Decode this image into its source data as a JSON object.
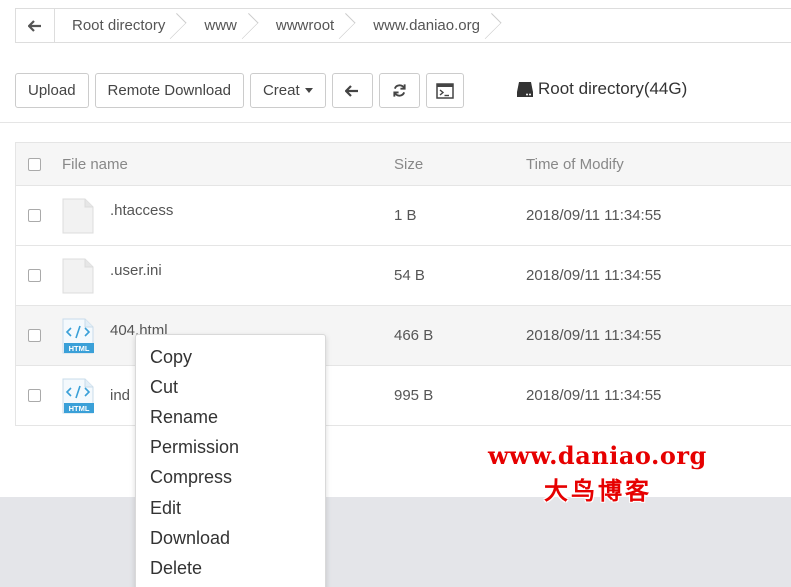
{
  "breadcrumb": {
    "items": [
      "Root directory",
      "www",
      "wwwroot",
      "www.daniao.org"
    ]
  },
  "toolbar": {
    "upload_label": "Upload",
    "remote_download_label": "Remote Download",
    "create_label": "Creat",
    "disk_label": "Root directory(44G)"
  },
  "table": {
    "headers": {
      "name": "File name",
      "size": "Size",
      "time": "Time of Modify"
    },
    "rows": [
      {
        "name": ".htaccess",
        "size": "1 B",
        "time": "2018/09/11 11:34:55",
        "type": "file"
      },
      {
        "name": ".user.ini",
        "size": "54 B",
        "time": "2018/09/11 11:34:55",
        "type": "file"
      },
      {
        "name": "404.html",
        "size": "466 B",
        "time": "2018/09/11 11:34:55",
        "type": "html"
      },
      {
        "name": "ind",
        "size": "995 B",
        "time": "2018/09/11 11:34:55",
        "type": "html"
      }
    ],
    "html_icon_label": "HTML"
  },
  "context_menu": {
    "items": [
      "Copy",
      "Cut",
      "Rename",
      "Permission",
      "Compress",
      "Edit",
      "Download",
      "Delete"
    ]
  },
  "watermark": {
    "line1": "www.daniao.org",
    "line2": "大鸟博客"
  },
  "colors": {
    "html_icon": "#3aa0d8",
    "watermark": "#e60000",
    "footer_gray": "#e4e5e9"
  }
}
